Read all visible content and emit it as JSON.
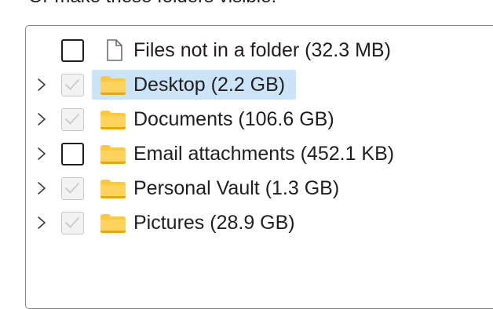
{
  "header": {
    "text": "Or make these folders visible:"
  },
  "tree": {
    "items": [
      {
        "label": "Files not in a folder  (32.3 MB)",
        "icon": "file-icon",
        "checkbox": "unchecked",
        "expandable": false,
        "selected": false
      },
      {
        "label": "Desktop  (2.2 GB)",
        "icon": "folder-icon",
        "checkbox": "checked-disabled",
        "expandable": true,
        "selected": true
      },
      {
        "label": "Documents  (106.6 GB)",
        "icon": "folder-icon",
        "checkbox": "checked-disabled",
        "expandable": true,
        "selected": false
      },
      {
        "label": "Email attachments  (452.1 KB)",
        "icon": "folder-icon",
        "checkbox": "unchecked",
        "expandable": true,
        "selected": false
      },
      {
        "label": "Personal Vault  (1.3 GB)",
        "icon": "folder-icon",
        "checkbox": "checked-disabled",
        "expandable": true,
        "selected": false
      },
      {
        "label": "Pictures  (28.9 GB)",
        "icon": "folder-icon",
        "checkbox": "checked-disabled",
        "expandable": true,
        "selected": false
      }
    ]
  },
  "colors": {
    "selection": "#cce4f7",
    "folder": "#ffc83d",
    "folder_dark": "#e8a317",
    "disabled_check": "#c4c4c4"
  }
}
